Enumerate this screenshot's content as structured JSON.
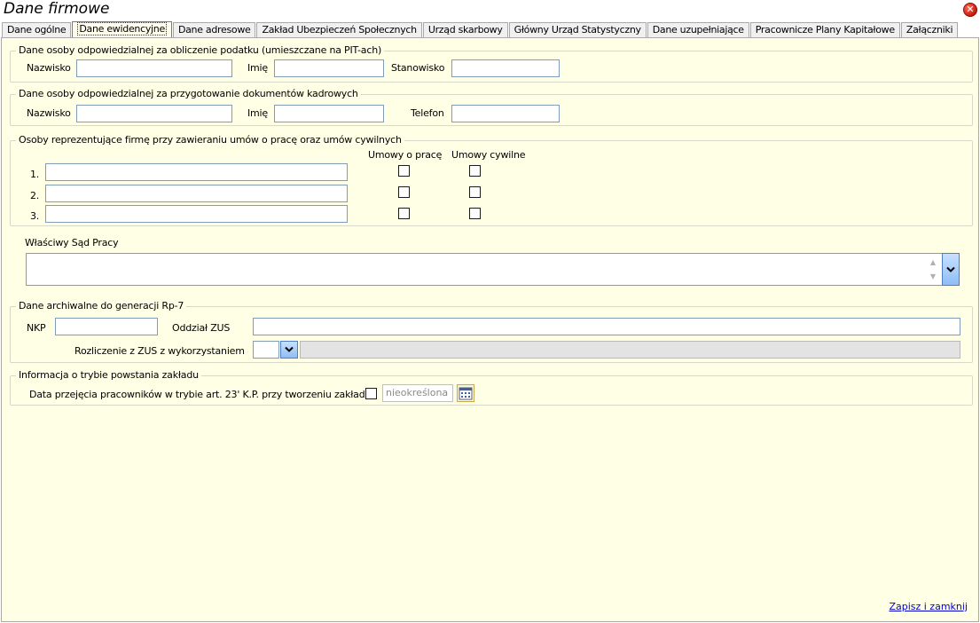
{
  "window": {
    "title": "Dane firmowe",
    "close_symbol": "✕"
  },
  "tabs": [
    {
      "label": "Dane ogólne"
    },
    {
      "label": "Dane ewidencyjne",
      "active": true
    },
    {
      "label": "Dane adresowe"
    },
    {
      "label": "Zakład Ubezpieczeń Społecznych"
    },
    {
      "label": "Urząd skarbowy"
    },
    {
      "label": "Główny Urząd Statystyczny"
    },
    {
      "label": "Dane uzupełniające"
    },
    {
      "label": "Pracownicze Plany Kapitałowe"
    },
    {
      "label": "Załączniki"
    }
  ],
  "pit": {
    "legend": "Dane osoby odpowiedzialnej za obliczenie podatku (umieszczane na PIT-ach)",
    "surname_label": "Nazwisko",
    "surname_value": "",
    "firstname_label": "Imię",
    "firstname_value": "",
    "position_label": "Stanowisko",
    "position_value": ""
  },
  "hr": {
    "legend": "Dane osoby odpowiedzialnej za przygotowanie dokumentów kadrowych",
    "surname_label": "Nazwisko",
    "surname_value": "",
    "firstname_label": "Imię",
    "firstname_value": "",
    "phone_label": "Telefon",
    "phone_value": ""
  },
  "representatives": {
    "legend": "Osoby reprezentujące firmę przy zawieraniu umów o pracę oraz umów cywilnych",
    "col_employment": "Umowy o pracę",
    "col_civil": "Umowy cywilne",
    "rows": [
      {
        "num": "1.",
        "value": "",
        "employment": false,
        "civil": false
      },
      {
        "num": "2.",
        "value": "",
        "employment": false,
        "civil": false
      },
      {
        "num": "3.",
        "value": "",
        "employment": false,
        "civil": false
      }
    ]
  },
  "labour_court": {
    "label": "Właściwy Sąd Pracy",
    "value": ""
  },
  "rp7": {
    "legend": "Dane archiwalne do generacji Rp-7",
    "nkp_label": "NKP",
    "nkp_value": "",
    "zus_branch_label": "Oddział ZUS",
    "zus_branch_value": "",
    "settlement_label": "Rozliczenie z ZUS z wykorzystaniem",
    "settlement_value": ""
  },
  "establishment": {
    "legend": "Informacja o trybie powstania zakładu",
    "takeover_label": "Data przejęcia pracowników w trybie art. 23' K.P. przy tworzeniu zakładu",
    "date_value": "nieokreślona"
  },
  "footer": {
    "save_close_label": "Zapisz i zamknij"
  },
  "colors": {
    "panel_bg": "#ffffe6",
    "input_border": "#7f9db9",
    "dropdown_button": "#8fbef4",
    "link": "#0000cc",
    "close_button": "#c81a0e"
  }
}
